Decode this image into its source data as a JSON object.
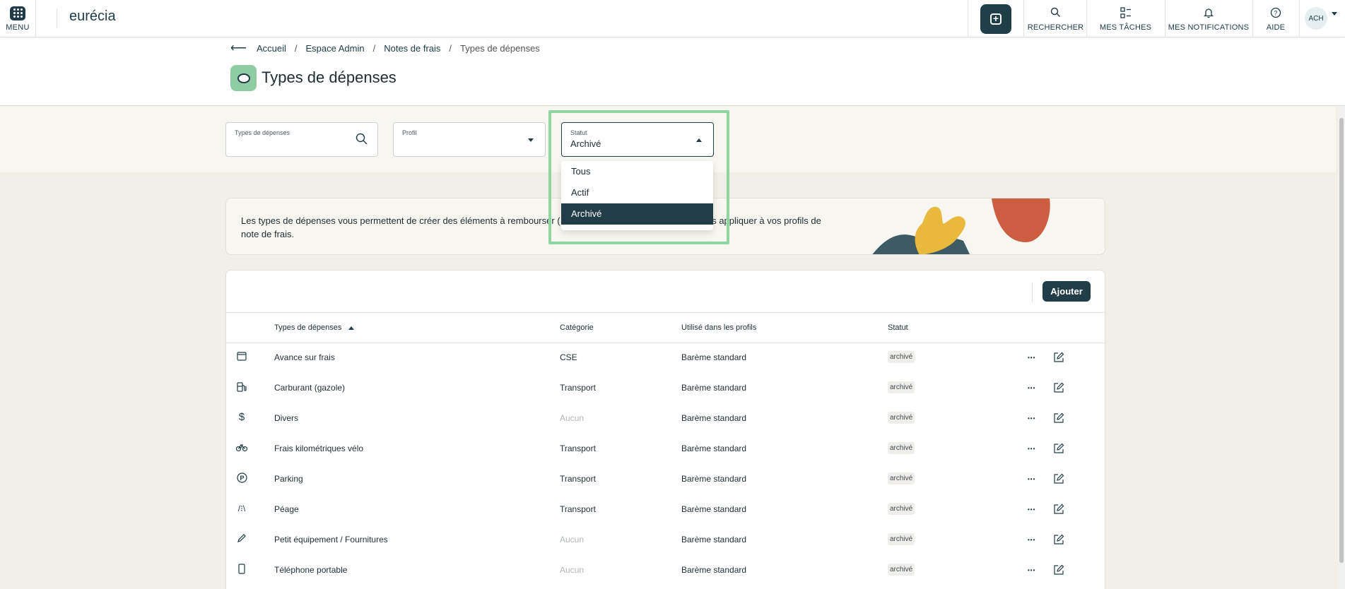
{
  "topbar": {
    "menu_label": "MENU",
    "logo": "eurécia",
    "nav": [
      {
        "label": "RECHERCHER",
        "icon": "search-icon"
      },
      {
        "label": "MES TÂCHES",
        "icon": "tasks-icon"
      },
      {
        "label": "MES NOTIFICATIONS",
        "icon": "bell-icon"
      },
      {
        "label": "AIDE",
        "icon": "help-icon"
      }
    ],
    "avatar": "ACH"
  },
  "breadcrumb": [
    "Accueil",
    "Espace Admin",
    "Notes de frais",
    "Types de dépenses"
  ],
  "page_title": "Types de dépenses",
  "filters": {
    "type": {
      "label": "Types de dépenses",
      "value": ""
    },
    "profil": {
      "label": "Profil",
      "value": ""
    },
    "statut": {
      "label": "Statut",
      "value": "Archivé",
      "options": [
        "Tous",
        "Actif",
        "Archivé"
      ],
      "selected": "Archivé"
    }
  },
  "banner": {
    "text": "Les types de dépenses vous permettent de créer des éléments à rembourser (ex : ...) que vous pourrez ensuite appliquer à vos profils de note de frais.",
    "text_visible_left": "Les types de dépenses vous permettent de créer des éléments à rembourser ( ex :",
    "text_visible_right": "s appliquer à vos profils de",
    "text_line2": "note de frais."
  },
  "table": {
    "add_label": "Ajouter",
    "columns": [
      "Types de dépenses",
      "Catégorie",
      "Utilisé dans les profils",
      "Statut"
    ],
    "rows": [
      {
        "icon": "calendar-icon",
        "name": "Avance sur frais",
        "category": "CSE",
        "profiles": "Barème standard",
        "status": "archivé"
      },
      {
        "icon": "fuel-pump-icon",
        "name": "Carburant (gazole)",
        "category": "Transport",
        "profiles": "Barème standard",
        "status": "archivé"
      },
      {
        "icon": "dollar-icon",
        "name": "Divers",
        "category": "Aucun",
        "profiles": "Barème standard",
        "status": "archivé"
      },
      {
        "icon": "bicycle-icon",
        "name": "Frais kilométriques vélo",
        "category": "Transport",
        "profiles": "Barème standard",
        "status": "archivé"
      },
      {
        "icon": "parking-icon",
        "name": "Parking",
        "category": "Transport",
        "profiles": "Barème standard",
        "status": "archivé"
      },
      {
        "icon": "road-icon",
        "name": "Péage",
        "category": "Transport",
        "profiles": "Barème standard",
        "status": "archivé"
      },
      {
        "icon": "pen-icon",
        "name": "Petit équipement / Fournitures",
        "category": "Aucun",
        "profiles": "Barème standard",
        "status": "archivé"
      },
      {
        "icon": "phone-icon",
        "name": "Téléphone portable",
        "category": "Aucun",
        "profiles": "Barème standard",
        "status": "archivé"
      }
    ]
  },
  "colors": {
    "primary": "#213d47",
    "highlight": "#8ed6a0",
    "accent_green": "#8fcba3"
  }
}
